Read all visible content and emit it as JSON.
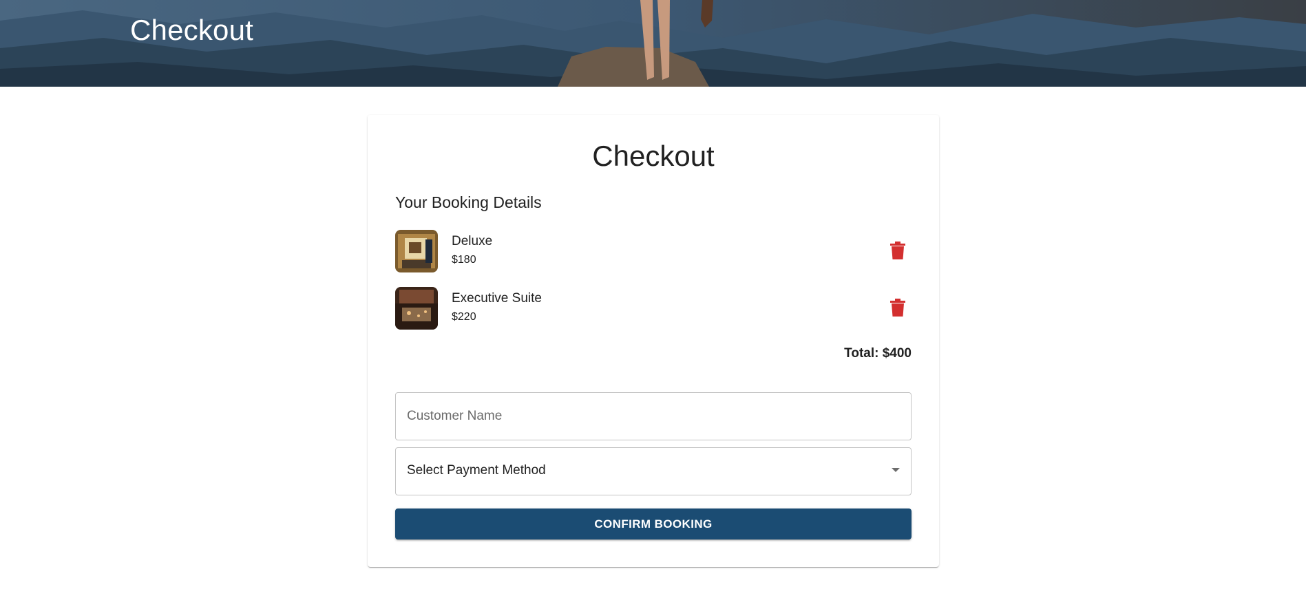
{
  "hero": {
    "title": "Checkout"
  },
  "card": {
    "title": "Checkout",
    "section_title": "Your Booking Details",
    "items": [
      {
        "name": "Deluxe",
        "price": "$180",
        "thumb_icon": "hotel-room-photo"
      },
      {
        "name": "Executive Suite",
        "price": "$220",
        "thumb_icon": "suite-room-photo"
      }
    ],
    "delete_icon": "trash-icon",
    "total": "Total: $400",
    "customer_name": {
      "value": "",
      "placeholder": "Customer Name"
    },
    "payment_select": {
      "selected": "Select Payment Method"
    },
    "confirm_label": "CONFIRM BOOKING"
  },
  "colors": {
    "primary": "#1b4c73",
    "delete": "#d32f2f",
    "text": "#212121"
  }
}
